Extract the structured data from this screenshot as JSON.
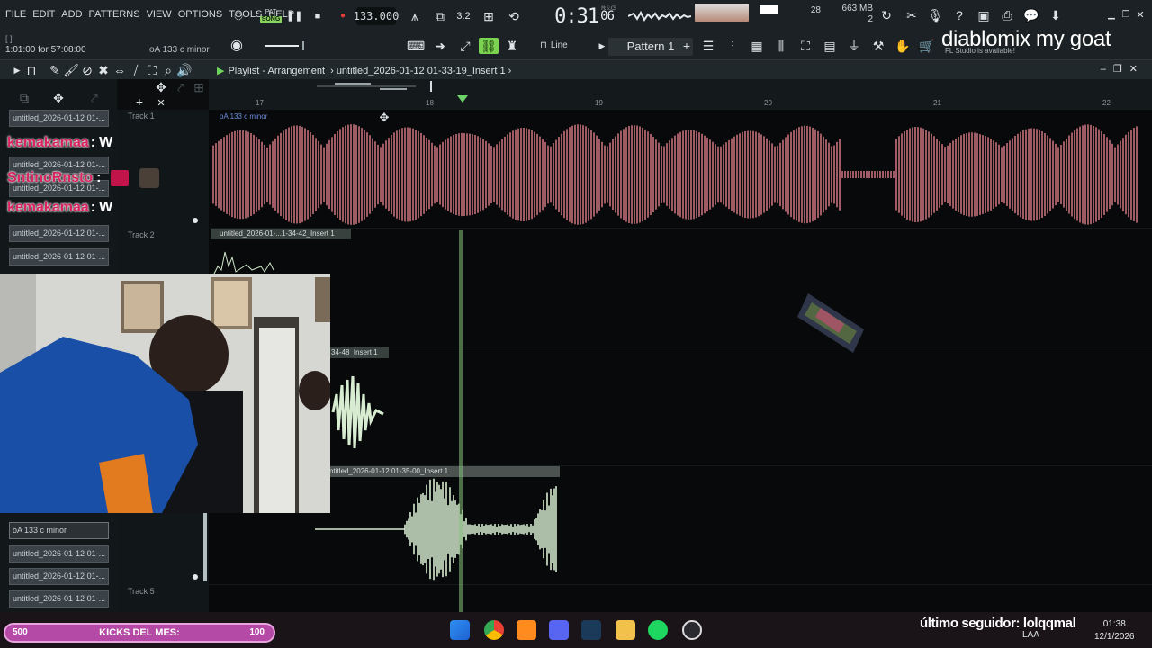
{
  "menu": [
    "FILE",
    "EDIT",
    "ADD",
    "PATTERNS",
    "VIEW",
    "OPTIONS",
    "TOOLS",
    "HELP"
  ],
  "transport": {
    "pat_label": "PAT",
    "song_label": "SONG",
    "tempo": "133.000"
  },
  "time": {
    "main": "0:31",
    "sub": "06",
    "msc": "M:S:CS"
  },
  "cpu": {
    "value": "28"
  },
  "memory": {
    "mb": "663 MB",
    "poly": "2"
  },
  "hint": {
    "bracket": "[ ]",
    "time": "1:01:00 for 57:08:00",
    "selection": "oA 133 c minor"
  },
  "snap": {
    "label": "Line"
  },
  "pattern": {
    "label": "Pattern 1"
  },
  "overlay": {
    "title": "diablomix my goat",
    "fl_notice": "FL Studio is available!"
  },
  "playlist": {
    "title": "Playlist - Arrangement",
    "crumb": "untitled_2026-01-12 01-33-19_Insert 1",
    "bars": [
      "17",
      "18",
      "19",
      "20",
      "21",
      "22"
    ]
  },
  "picker": [
    "untitled_2026-01-12 01-...",
    "untitled_2026-01-12 01-...",
    "untitled_2026-01-12 01-...",
    "untitled_2026-01-12 01-...",
    "untitled_2026-01-12 01-...",
    "oA 133 c minor",
    "untitled_2026-01-12 01-...",
    "untitled_2026-01-12 01-...",
    "untitled_2026-01-12 01-..."
  ],
  "tracks": [
    "Track 1",
    "Track 2",
    "Track 5"
  ],
  "clips": {
    "c1": "oA 133 c minor",
    "c2": "untitled_2026-01-...1-34-42_Insert 1",
    "c3": "34-48_Insert 1",
    "c4": "ntitled_2026-01-12 01-35-00_Insert 1"
  },
  "chat": [
    {
      "user": "kemakamaa",
      "msg": "W"
    },
    {
      "user": "SntinoRnsto",
      "msg": ":"
    },
    {
      "user": "kemakamaa",
      "msg": "W"
    }
  ],
  "taskbar": {
    "progress_left": "500",
    "progress_label": "KICKS DEL MES:",
    "progress_right": "100",
    "follower": "último seguidor: lolqqmal",
    "lang": "LAA",
    "clock_time": "01:38",
    "clock_date": "12/1/2026"
  },
  "colors": {
    "accent": "#8bd35f",
    "clip_red": "#e0808a",
    "clip_green": "#d7ecd0",
    "chat_user": "#d9245f",
    "progress": "#b44aa6"
  }
}
